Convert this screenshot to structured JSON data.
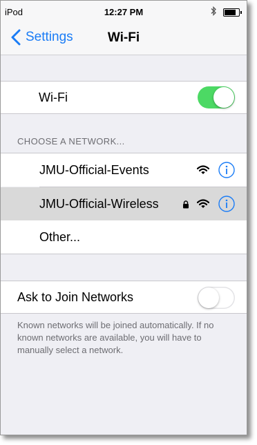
{
  "status_bar": {
    "carrier": "iPod",
    "time": "12:27 PM",
    "bluetooth_icon": "bluetooth-icon",
    "battery_level": 0.9
  },
  "nav": {
    "back_label": "Settings",
    "title": "Wi-Fi"
  },
  "wifi": {
    "label": "Wi-Fi",
    "enabled": true
  },
  "networks_header": "CHOOSE A NETWORK...",
  "networks": [
    {
      "name": "JMU-Official-Events",
      "locked": false,
      "selected": false
    },
    {
      "name": "JMU-Official-Wireless",
      "locked": true,
      "selected": true
    },
    {
      "name": "Other..."
    }
  ],
  "ask_to_join": {
    "label": "Ask to Join Networks",
    "enabled": false,
    "note": "Known networks will be joined automatically. If no known networks are available, you will have to manually select a network."
  },
  "colors": {
    "accent": "#1a7cf6",
    "toggle_on": "#4cd964",
    "selected_row": "#d9d9d9"
  }
}
